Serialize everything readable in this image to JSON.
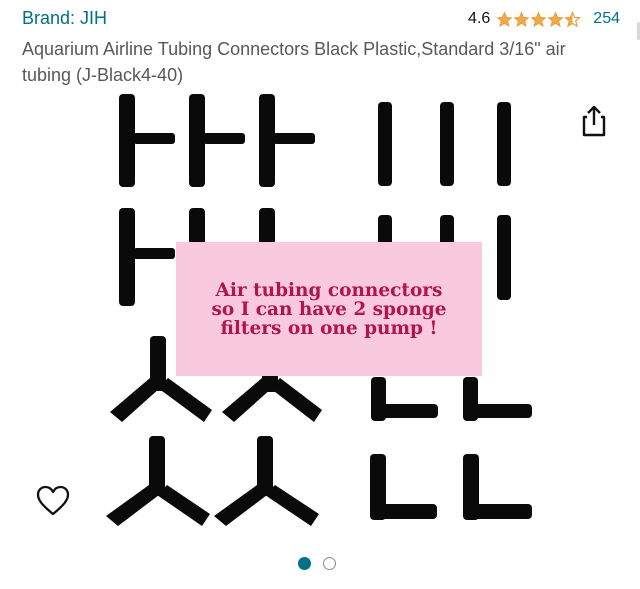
{
  "header": {
    "brand": "Brand: JIH",
    "rating_value": "4.6",
    "rating_stars": 4.6,
    "rating_count": "254"
  },
  "product": {
    "title": "Aquarium Airline Tubing Connectors Black Plastic,Standard 3/16\" air tubing (J-Black4-40)"
  },
  "image": {
    "overlay_text": "Air tubing connectors\nso I can have 2 sponge\nfilters on one pump !",
    "current_index": 1,
    "total_images": 2
  },
  "icons": {
    "share": "share-icon",
    "wishlist": "heart-icon",
    "star": "star-icon"
  },
  "colors": {
    "link": "#007185",
    "star": "#f3a847",
    "overlay_bg": "#f9c9dd",
    "overlay_text": "#b0154b",
    "dot_active": "#017185"
  }
}
